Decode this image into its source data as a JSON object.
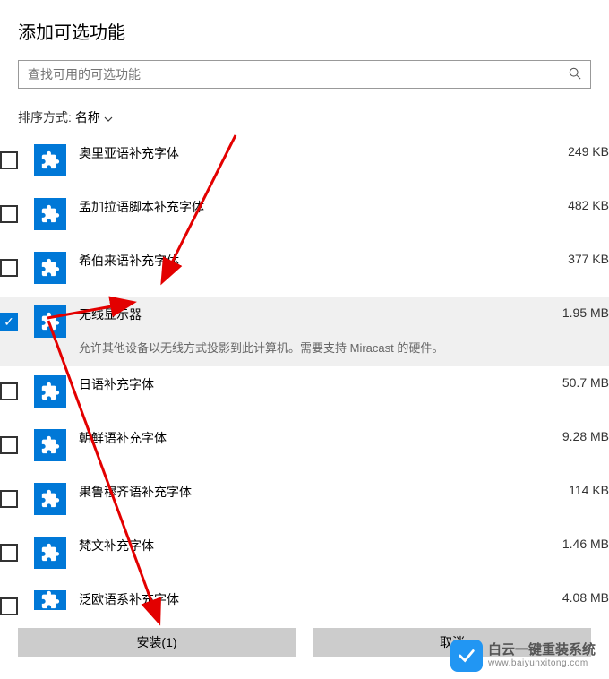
{
  "title": "添加可选功能",
  "search": {
    "placeholder": "查找可用的可选功能"
  },
  "sort": {
    "label": "排序方式:",
    "value": "名称"
  },
  "features": [
    {
      "name": "奥里亚语补充字体",
      "size": "249 KB",
      "checked": false
    },
    {
      "name": "孟加拉语脚本补充字体",
      "size": "482 KB",
      "checked": false
    },
    {
      "name": "希伯来语补充字体",
      "size": "377 KB",
      "checked": false
    },
    {
      "name": "无线显示器",
      "size": "1.95 MB",
      "checked": true,
      "desc": "允许其他设备以无线方式投影到此计算机。需要支持 Miracast 的硬件。"
    },
    {
      "name": "日语补充字体",
      "size": "50.7 MB",
      "checked": false
    },
    {
      "name": "朝鲜语补充字体",
      "size": "9.28 MB",
      "checked": false
    },
    {
      "name": "果鲁穆齐语补充字体",
      "size": "114 KB",
      "checked": false
    },
    {
      "name": "梵文补充字体",
      "size": "1.46 MB",
      "checked": false
    },
    {
      "name": "泛欧语系补充字体",
      "size": "4.08 MB",
      "checked": false
    }
  ],
  "buttons": {
    "install": "安装(1)",
    "cancel": "取消"
  },
  "watermark": {
    "main": "白云一键重装系统",
    "sub": "www.baiyunxitong.com"
  }
}
